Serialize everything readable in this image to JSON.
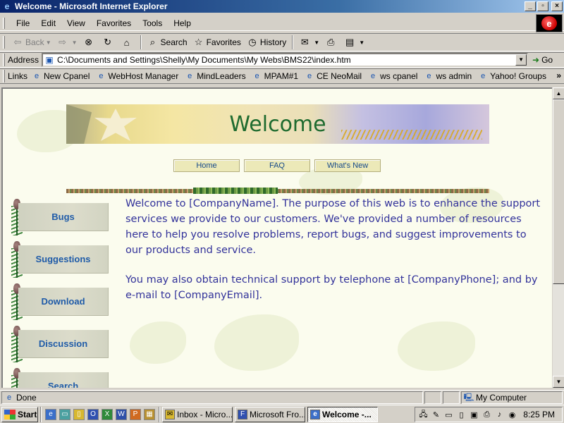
{
  "window": {
    "title": "Welcome - Microsoft Internet Explorer",
    "controls": {
      "minimize": "_",
      "maximize": "▫",
      "close": "×"
    }
  },
  "menu": [
    "File",
    "Edit",
    "View",
    "Favorites",
    "Tools",
    "Help"
  ],
  "toolbar": {
    "back": "Back",
    "search": "Search",
    "favorites": "Favorites",
    "history": "History"
  },
  "address": {
    "label": "Address",
    "url": "C:\\Documents and Settings\\Shelly\\My Documents\\My Webs\\BMS22\\index.htm",
    "go": "Go"
  },
  "links": {
    "label": "Links",
    "items": [
      "New Cpanel",
      "WebHost Manager",
      "MindLeaders",
      "MPAM#1",
      "CE NeoMail",
      "ws cpanel",
      "ws admin",
      "Yahoo! Groups"
    ],
    "more": "»"
  },
  "page": {
    "banner_title": "Welcome",
    "nav": [
      "Home",
      "FAQ",
      "What's New"
    ],
    "sidebar": [
      "Bugs",
      "Suggestions",
      "Download",
      "Discussion",
      "Search"
    ],
    "paragraphs": [
      "Welcome to [CompanyName]. The purpose of this web is to enhance the support services we provide to our customers. We've provided a number of resources here to help you resolve problems, report bugs, and suggest improvements to our products and service.",
      "You may also obtain technical support by telephone at [CompanyPhone]; and by e-mail to [CompanyEmail]."
    ]
  },
  "status": {
    "text": "Done",
    "zone": "My Computer"
  },
  "taskbar": {
    "start": "Start",
    "tasks": [
      "Inbox - Micro...",
      "Microsoft Fro...",
      "Welcome -..."
    ],
    "clock": "8:25 PM"
  },
  "colors": {
    "title_bar": "#0a246a",
    "page_text": "#32329a",
    "banner_text": "#1e6b2f",
    "sidebar_text": "#1f5ba8"
  }
}
